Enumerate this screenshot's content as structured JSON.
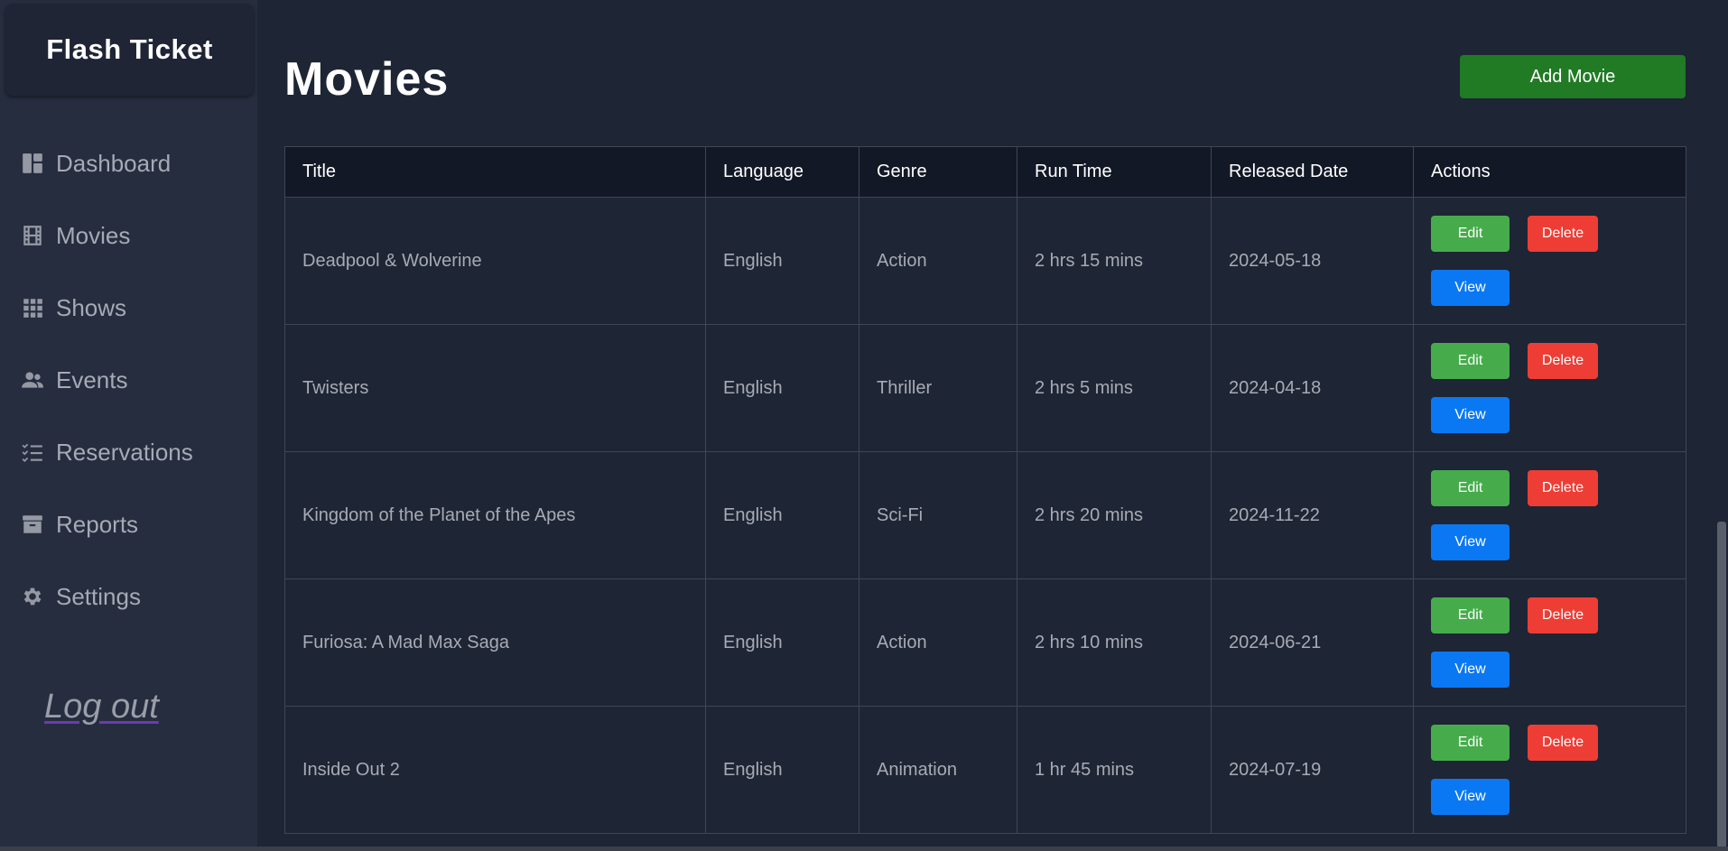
{
  "sidebar": {
    "brand": "Flash Ticket",
    "items": [
      {
        "label": "Dashboard",
        "icon": "dashboard-icon"
      },
      {
        "label": "Movies",
        "icon": "film-icon"
      },
      {
        "label": "Shows",
        "icon": "grid-icon"
      },
      {
        "label": "Events",
        "icon": "people-icon"
      },
      {
        "label": "Reservations",
        "icon": "checklist-icon"
      },
      {
        "label": "Reports",
        "icon": "archive-icon"
      },
      {
        "label": "Settings",
        "icon": "gear-icon"
      }
    ],
    "logout": "Log out"
  },
  "main": {
    "title": "Movies",
    "add_button": "Add Movie",
    "columns": [
      "Title",
      "Language",
      "Genre",
      "Run Time",
      "Released Date",
      "Actions"
    ],
    "rows": [
      {
        "title": "Deadpool & Wolverine",
        "language": "English",
        "genre": "Action",
        "runtime": "2 hrs 15 mins",
        "released": "2024-05-18"
      },
      {
        "title": "Twisters",
        "language": "English",
        "genre": "Thriller",
        "runtime": "2 hrs 5 mins",
        "released": "2024-04-18"
      },
      {
        "title": "Kingdom of the Planet of the Apes",
        "language": "English",
        "genre": "Sci-Fi",
        "runtime": "2 hrs 20 mins",
        "released": "2024-11-22"
      },
      {
        "title": "Furiosa: A Mad Max Saga",
        "language": "English",
        "genre": "Action",
        "runtime": "2 hrs 10 mins",
        "released": "2024-06-21"
      },
      {
        "title": "Inside Out 2",
        "language": "English",
        "genre": "Animation",
        "runtime": "1 hr 45 mins",
        "released": "2024-07-19"
      }
    ],
    "actions": {
      "edit": "Edit",
      "delete": "Delete",
      "view": "View"
    }
  },
  "colors": {
    "background": "#1e2535",
    "sidebar": "#262d3f",
    "add_button": "#217a24",
    "edit": "#46ac4b",
    "delete": "#ee3d35",
    "view": "#0b78f3"
  }
}
